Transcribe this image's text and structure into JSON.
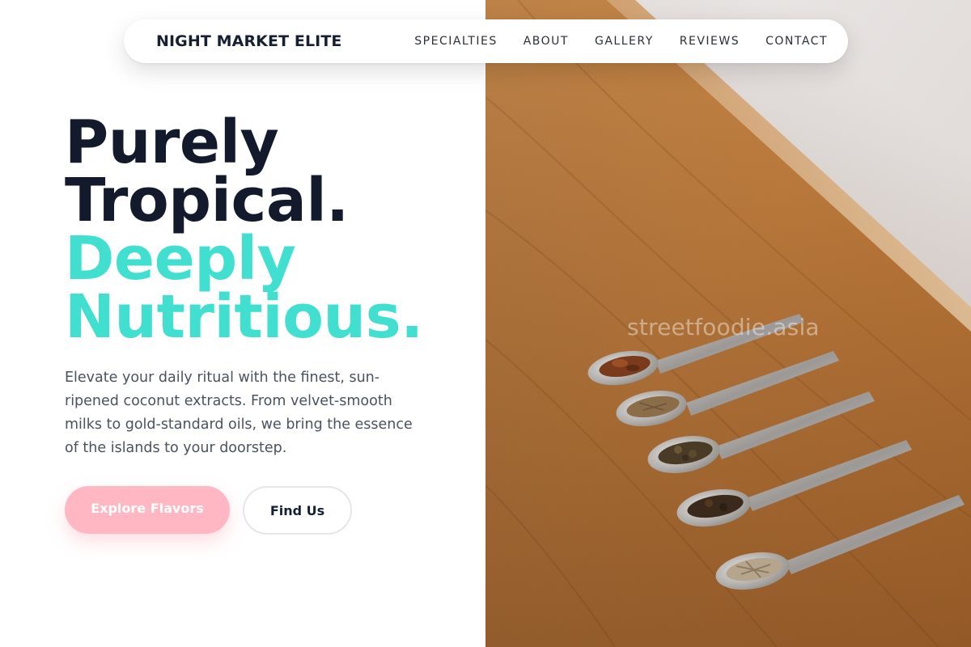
{
  "nav": {
    "brand": "NIGHT MARKET ELITE",
    "links": [
      {
        "label": "SPECIALTIES"
      },
      {
        "label": "ABOUT"
      },
      {
        "label": "GALLERY"
      },
      {
        "label": "REVIEWS"
      },
      {
        "label": "CONTACT"
      }
    ]
  },
  "hero": {
    "headline_line1": "Purely",
    "headline_line2": "Tropical.",
    "headline_line3": "Deeply",
    "headline_line4": "Nutritious.",
    "description": "Elevate your daily ritual with the finest, sun-ripened coconut extracts. From velvet-smooth milks to gold-standard oils, we bring the essence of the islands to your doorstep.",
    "primary_button": "Explore Flavors",
    "secondary_button": "Find Us"
  },
  "image": {
    "watermark": "streetfoodie.asia",
    "subject": "five metal spoons holding dried spices on a wooden bench"
  },
  "colors": {
    "headline_dark": "#121a2c",
    "headline_accent": "#40dfd0",
    "primary_button": "#ffb8c3",
    "body_text": "#4a5260"
  }
}
